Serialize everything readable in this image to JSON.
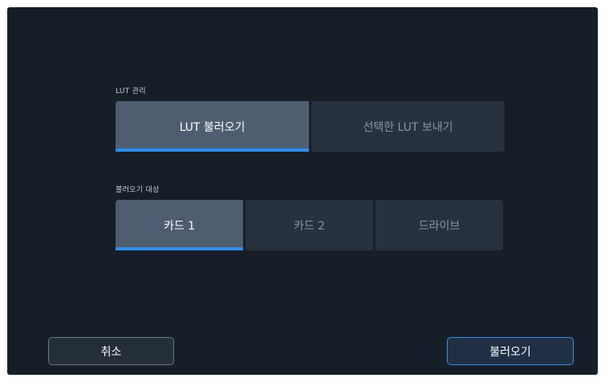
{
  "lut_management": {
    "label": "LUT 관리",
    "options": [
      {
        "label": "LUT 불러오기",
        "active": true
      },
      {
        "label": "선택한 LUT 보내기",
        "active": false
      }
    ]
  },
  "import_target": {
    "label": "불러오기 대상",
    "options": [
      {
        "label": "카드 1",
        "active": true
      },
      {
        "label": "카드 2",
        "active": false
      },
      {
        "label": "드라이브",
        "active": false
      }
    ]
  },
  "footer": {
    "cancel_label": "취소",
    "import_label": "불러오기"
  },
  "colors": {
    "accent": "#2f8eea",
    "background": "#161e28",
    "active_segment": "#4e5d72",
    "inactive_segment": "#27313f"
  }
}
